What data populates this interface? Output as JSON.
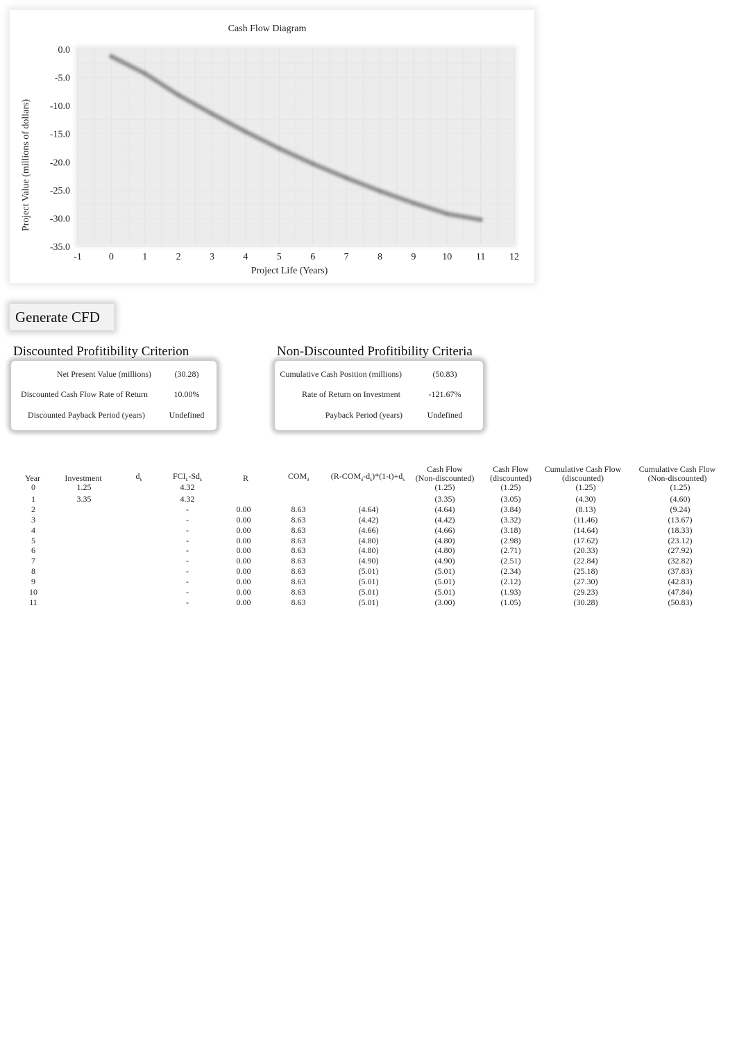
{
  "chart_data": {
    "type": "line",
    "title": "Cash Flow Diagram",
    "xlabel": "Project Life (Years)",
    "ylabel": "Project Value (millions of dollars)",
    "xlim": [
      -1,
      12
    ],
    "ylim": [
      -35,
      0
    ],
    "x_ticks": [
      "-1",
      "0",
      "1",
      "2",
      "3",
      "4",
      "5",
      "6",
      "7",
      "8",
      "9",
      "10",
      "11",
      "12"
    ],
    "y_ticks": [
      "0.0",
      "-5.0",
      "-10.0",
      "-15.0",
      "-20.0",
      "-25.0",
      "-30.0",
      "-35.0"
    ],
    "grid": true,
    "legend": "none",
    "series": [
      {
        "name": "Cumulative Cash Flow (discounted)",
        "x": [
          0,
          1,
          2,
          3,
          4,
          5,
          6,
          7,
          8,
          9,
          10,
          11
        ],
        "y": [
          -1.25,
          -4.3,
          -8.13,
          -11.46,
          -14.64,
          -17.62,
          -20.33,
          -22.84,
          -25.18,
          -27.3,
          -29.23,
          -30.28
        ],
        "color": "#777777"
      }
    ]
  },
  "generate_button": {
    "label": "Generate CFD"
  },
  "discounted": {
    "title": "Discounted Profitibility Criterion",
    "rows": [
      {
        "label": "Net Present Value (millions)",
        "value": "(30.28)"
      },
      {
        "label": "Discounted Cash Flow Rate of Return",
        "value": "10.00%"
      },
      {
        "label": "Discounted Payback Period (years)",
        "value": "Undefined"
      }
    ]
  },
  "non_discounted": {
    "title": "Non-Discounted Profitibility Criteria",
    "rows": [
      {
        "label": "Cumulative Cash Position (millions)",
        "value": "(50.83)"
      },
      {
        "label": "Rate of Return on Investment",
        "value": "-121.67%"
      },
      {
        "label": "Payback Period (years)",
        "value": "Undefined"
      }
    ]
  },
  "table": {
    "headers": {
      "year": "Year",
      "investment": "Investment",
      "dk_main": "d",
      "dk_sub": "k",
      "fci_a": "FCI",
      "fci_sub1": "L",
      "fci_b": "-Sd",
      "fci_sub2": "k",
      "r": "R",
      "com_main": "COM",
      "com_sub": "d",
      "formula_a": "(R-COM",
      "formula_sub1": "d",
      "formula_b": "-d",
      "formula_sub2": "k",
      "formula_c": ")*(1-t)+d",
      "formula_sub3": "k",
      "cf_nd_1": "Cash Flow",
      "cf_nd_2": "(Non-discounted)",
      "cf_d_1": "Cash Flow",
      "cf_d_2": "(discounted)",
      "ccf_d_1": "Cumulative Cash Flow",
      "ccf_d_2": "(discounted)",
      "ccf_nd_1": "Cumulative Cash Flow",
      "ccf_nd_2": "(Non-discounted)"
    },
    "rows": [
      {
        "year": "0",
        "investment": "1.25",
        "dk": "",
        "fci": "4.32",
        "r": "",
        "com": "",
        "formula": "",
        "cf_nd": "(1.25)",
        "cf_d": "(1.25)",
        "ccf_d": "(1.25)",
        "ccf_nd": "(1.25)"
      },
      {
        "year": "1",
        "investment": "3.35",
        "dk": "",
        "fci": "4.32",
        "r": "",
        "com": "",
        "formula": "",
        "cf_nd": "(3.35)",
        "cf_d": "(3.05)",
        "ccf_d": "(4.30)",
        "ccf_nd": "(4.60)"
      },
      {
        "year": "2",
        "investment": "",
        "dk": "",
        "fci": "-",
        "r": "0.00",
        "com": "8.63",
        "formula": "(4.64)",
        "cf_nd": "(4.64)",
        "cf_d": "(3.84)",
        "ccf_d": "(8.13)",
        "ccf_nd": "(9.24)"
      },
      {
        "year": "3",
        "investment": "",
        "dk": "",
        "fci": "-",
        "r": "0.00",
        "com": "8.63",
        "formula": "(4.42)",
        "cf_nd": "(4.42)",
        "cf_d": "(3.32)",
        "ccf_d": "(11.46)",
        "ccf_nd": "(13.67)"
      },
      {
        "year": "4",
        "investment": "",
        "dk": "",
        "fci": "-",
        "r": "0.00",
        "com": "8.63",
        "formula": "(4.66)",
        "cf_nd": "(4.66)",
        "cf_d": "(3.18)",
        "ccf_d": "(14.64)",
        "ccf_nd": "(18.33)"
      },
      {
        "year": "5",
        "investment": "",
        "dk": "",
        "fci": "-",
        "r": "0.00",
        "com": "8.63",
        "formula": "(4.80)",
        "cf_nd": "(4.80)",
        "cf_d": "(2.98)",
        "ccf_d": "(17.62)",
        "ccf_nd": "(23.12)"
      },
      {
        "year": "6",
        "investment": "",
        "dk": "",
        "fci": "-",
        "r": "0.00",
        "com": "8.63",
        "formula": "(4.80)",
        "cf_nd": "(4.80)",
        "cf_d": "(2.71)",
        "ccf_d": "(20.33)",
        "ccf_nd": "(27.92)"
      },
      {
        "year": "7",
        "investment": "",
        "dk": "",
        "fci": "-",
        "r": "0.00",
        "com": "8.63",
        "formula": "(4.90)",
        "cf_nd": "(4.90)",
        "cf_d": "(2.51)",
        "ccf_d": "(22.84)",
        "ccf_nd": "(32.82)"
      },
      {
        "year": "8",
        "investment": "",
        "dk": "",
        "fci": "-",
        "r": "0.00",
        "com": "8.63",
        "formula": "(5.01)",
        "cf_nd": "(5.01)",
        "cf_d": "(2.34)",
        "ccf_d": "(25.18)",
        "ccf_nd": "(37.83)"
      },
      {
        "year": "9",
        "investment": "",
        "dk": "",
        "fci": "-",
        "r": "0.00",
        "com": "8.63",
        "formula": "(5.01)",
        "cf_nd": "(5.01)",
        "cf_d": "(2.12)",
        "ccf_d": "(27.30)",
        "ccf_nd": "(42.83)"
      },
      {
        "year": "10",
        "investment": "",
        "dk": "",
        "fci": "-",
        "r": "0.00",
        "com": "8.63",
        "formula": "(5.01)",
        "cf_nd": "(5.01)",
        "cf_d": "(1.93)",
        "ccf_d": "(29.23)",
        "ccf_nd": "(47.84)"
      },
      {
        "year": "11",
        "investment": "",
        "dk": "",
        "fci": "-",
        "r": "0.00",
        "com": "8.63",
        "formula": "(5.01)",
        "cf_nd": "(3.00)",
        "cf_d": "(1.05)",
        "ccf_d": "(30.28)",
        "ccf_nd": "(50.83)"
      }
    ]
  }
}
